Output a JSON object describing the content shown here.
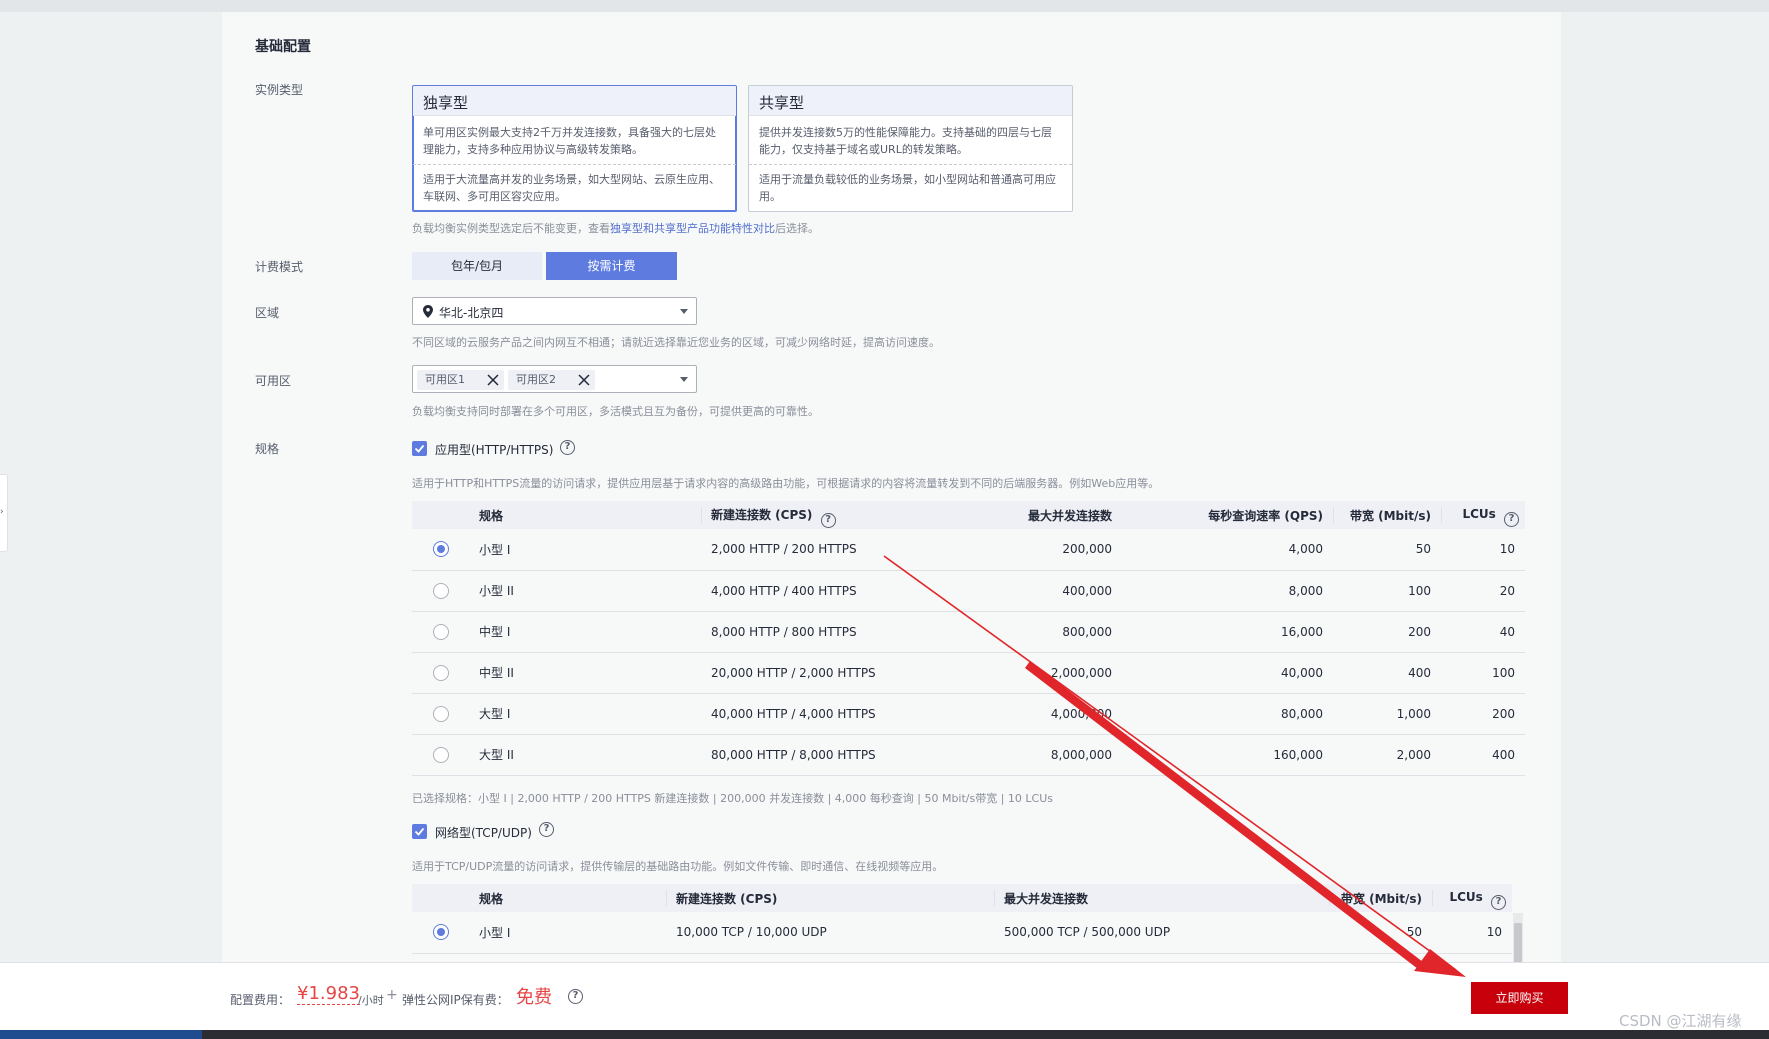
{
  "section": {
    "title": "基础配置"
  },
  "instance_type": {
    "label": "实例类型",
    "cards": [
      {
        "title": "独享型",
        "desc": "单可用区实例最大支持2千万并发连接数，具备强大的七层处理能力，支持多种应用协议与高级转发策略。",
        "use": "适用于大流量高并发的业务场景，如大型网站、云原生应用、车联网、多可用区容灾应用。",
        "selected": true
      },
      {
        "title": "共享型",
        "desc": "提供并发连接数5万的性能保障能力。支持基础的四层与七层能力，仅支持基于域名或URL的转发策略。",
        "use": "适用于流量负载较低的业务场景，如小型网站和普通高可用应用。",
        "selected": false
      }
    ],
    "hint_prefix": "负载均衡实例类型选定后不能变更，查看",
    "hint_link": "独享型和共享型产品功能特性对比",
    "hint_suffix": "后选择。"
  },
  "billing": {
    "label": "计费模式",
    "options": [
      "包年/包月",
      "按需计费"
    ],
    "selected": "按需计费"
  },
  "region": {
    "label": "区域",
    "value": "华北-北京四",
    "hint": "不同区域的云服务产品之间内网互不相通；请就近选择靠近您业务的区域，可减少网络时延，提高访问速度。"
  },
  "az": {
    "label": "可用区",
    "tags": [
      "可用区1",
      "可用区2"
    ],
    "hint": "负载均衡支持同时部署在多个可用区，多活模式且互为备份，可提供更高的可靠性。"
  },
  "spec": {
    "label": "规格",
    "app": {
      "checkbox_label": "应用型(HTTP/HTTPS)",
      "hint": "适用于HTTP和HTTPS流量的访问请求，提供应用层基于请求内容的高级路由功能，可根据请求的内容将流量转发到不同的后端服务器。例如Web应用等。",
      "headers": [
        "规格",
        "新建连接数 (CPS)",
        "最大并发连接数",
        "每秒查询速率 (QPS)",
        "带宽 (Mbit/s)",
        "LCUs"
      ],
      "rows": [
        {
          "name": "小型 I",
          "cps": "2,000 HTTP / 200 HTTPS",
          "max": "200,000",
          "qps": "4,000",
          "bw": "50",
          "lcu": "10",
          "selected": true
        },
        {
          "name": "小型 II",
          "cps": "4,000 HTTP / 400 HTTPS",
          "max": "400,000",
          "qps": "8,000",
          "bw": "100",
          "lcu": "20",
          "selected": false
        },
        {
          "name": "中型 I",
          "cps": "8,000 HTTP / 800 HTTPS",
          "max": "800,000",
          "qps": "16,000",
          "bw": "200",
          "lcu": "40",
          "selected": false
        },
        {
          "name": "中型 II",
          "cps": "20,000 HTTP / 2,000 HTTPS",
          "max": "2,000,000",
          "qps": "40,000",
          "bw": "400",
          "lcu": "100",
          "selected": false
        },
        {
          "name": "大型 I",
          "cps": "40,000 HTTP / 4,000 HTTPS",
          "max": "4,000,000",
          "qps": "80,000",
          "bw": "1,000",
          "lcu": "200",
          "selected": false
        },
        {
          "name": "大型 II",
          "cps": "80,000 HTTP / 8,000 HTTPS",
          "max": "8,000,000",
          "qps": "160,000",
          "bw": "2,000",
          "lcu": "400",
          "selected": false
        }
      ],
      "selected_summary": "已选择规格：小型 I | 2,000 HTTP / 200 HTTPS 新建连接数 | 200,000 并发连接数 | 4,000 每秒查询 | 50 Mbit/s带宽 | 10 LCUs"
    },
    "net": {
      "checkbox_label": "网络型(TCP/UDP)",
      "hint": "适用于TCP/UDP流量的访问请求，提供传输层的基础路由功能。例如文件传输、即时通信、在线视频等应用。",
      "headers": [
        "规格",
        "新建连接数 (CPS)",
        "最大并发连接数",
        "带宽 (Mbit/s)",
        "LCUs"
      ],
      "rows": [
        {
          "name": "小型 I",
          "cps": "10,000 TCP / 10,000 UDP",
          "max": "500,000 TCP / 500,000 UDP",
          "bw": "50",
          "lcu": "10",
          "selected": true
        }
      ]
    }
  },
  "footer": {
    "fee_label": "配置费用：",
    "price": "¥1.983",
    "unit": "/小时",
    "plus": "+",
    "eip_label": "弹性公网IP保有费：",
    "eip_value": "免费",
    "buy_label": "立即购买"
  },
  "watermark": "CSDN @江湖有缘",
  "colors": {
    "accent": "#5e7ce0",
    "buy": "#c7000b",
    "price": "#e54545",
    "annotation_arrow": "#e0262a"
  }
}
